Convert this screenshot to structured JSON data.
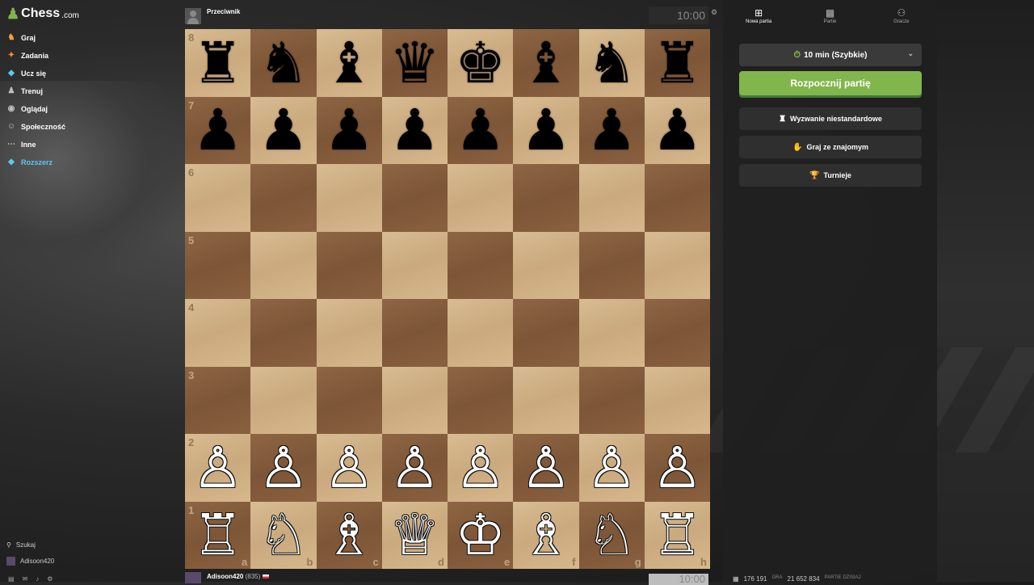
{
  "app": {
    "logo_text": "Chess",
    "logo_suffix": ".com"
  },
  "sidebar": {
    "items": [
      {
        "label": "Graj",
        "icon": "play-icon",
        "glyph": "♞",
        "color": "#ff9f43"
      },
      {
        "label": "Zadania",
        "icon": "puzzle-icon",
        "glyph": "✦",
        "color": "#ff8a3d"
      },
      {
        "label": "Ucz się",
        "icon": "learn-icon",
        "glyph": "◆",
        "color": "#5cc8f5"
      },
      {
        "label": "Trenuj",
        "icon": "train-icon",
        "glyph": "♟",
        "color": "#c0c0c0"
      },
      {
        "label": "Oglądaj",
        "icon": "watch-icon",
        "glyph": "◉",
        "color": "#c0c0c0"
      },
      {
        "label": "Społeczność",
        "icon": "community-icon",
        "glyph": "☺",
        "color": "#c0c0c0"
      },
      {
        "label": "Inne",
        "icon": "more-icon",
        "glyph": "⋯",
        "color": "#c0c0c0"
      },
      {
        "label": "Rozszerz",
        "icon": "diamond-icon",
        "glyph": "◆",
        "color": "#5cc8f5"
      }
    ],
    "search_label": "Szukaj",
    "username": "Adisoon420"
  },
  "opponent": {
    "name": "Przeciwnik",
    "clock": "10:00"
  },
  "player": {
    "name": "Adisoon420",
    "rating": "(835)",
    "clock": "10:00"
  },
  "board": {
    "ranks": [
      "8",
      "7",
      "6",
      "5",
      "4",
      "3",
      "2",
      "1"
    ],
    "files": [
      "a",
      "b",
      "c",
      "d",
      "e",
      "f",
      "g",
      "h"
    ],
    "pieces": [
      [
        "♜",
        "♞",
        "♝",
        "♛",
        "♚",
        "♝",
        "♞",
        "♜"
      ],
      [
        "♟",
        "♟",
        "♟",
        "♟",
        "♟",
        "♟",
        "♟",
        "♟"
      ],
      [
        "",
        "",
        "",
        "",
        "",
        "",
        "",
        ""
      ],
      [
        "",
        "",
        "",
        "",
        "",
        "",
        "",
        ""
      ],
      [
        "",
        "",
        "",
        "",
        "",
        "",
        "",
        ""
      ],
      [
        "",
        "",
        "",
        "",
        "",
        "",
        "",
        ""
      ],
      [
        "♙",
        "♙",
        "♙",
        "♙",
        "♙",
        "♙",
        "♙",
        "♙"
      ],
      [
        "♖",
        "♘",
        "♗",
        "♕",
        "♔",
        "♗",
        "♘",
        "♖"
      ]
    ],
    "colors": {
      "light": "#d4b58b",
      "dark": "#86603f"
    }
  },
  "panel": {
    "tabs": [
      {
        "label": "Nowa partia",
        "icon": "plus-icon",
        "glyph": "⊞"
      },
      {
        "label": "Partie",
        "icon": "games-icon",
        "glyph": "▦"
      },
      {
        "label": "Gracze",
        "icon": "players-icon",
        "glyph": "⚇"
      }
    ],
    "time_control": "10 min (Szybkie)",
    "play_button": "Rozpocznij partię",
    "options": [
      {
        "label": "Wyzwanie niestandardowe",
        "icon": "custom-challenge-icon",
        "glyph": "♜"
      },
      {
        "label": "Graj ze znajomym",
        "icon": "handshake-icon",
        "glyph": "✋"
      },
      {
        "label": "Turnieje",
        "icon": "trophy-icon",
        "glyph": "🏆"
      }
    ],
    "stats": {
      "games_count": "176 191",
      "games_label": "GRA",
      "today_count": "21 652 834",
      "today_label": "PARTIE DZISIAJ"
    }
  },
  "colors": {
    "accent_green": "#81b64c",
    "accent_blue": "#5cc8f5"
  }
}
